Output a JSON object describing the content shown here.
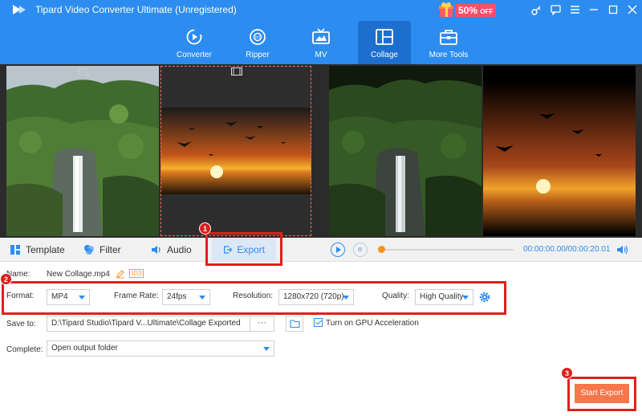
{
  "window": {
    "title": "Tipard Video Converter Ultimate (Unregistered)",
    "promo": {
      "percent": "50%",
      "suffix": "OFF"
    },
    "icons": [
      "key-icon",
      "chat-icon",
      "menu-icon",
      "minimize-icon",
      "maximize-icon",
      "close-icon"
    ]
  },
  "nav": {
    "tabs": [
      {
        "label": "Converter",
        "icon": "converter-icon"
      },
      {
        "label": "Ripper",
        "icon": "ripper-icon"
      },
      {
        "label": "MV",
        "icon": "mv-icon"
      },
      {
        "label": "Collage",
        "icon": "collage-icon",
        "active": true
      },
      {
        "label": "More Tools",
        "icon": "toolbox-icon"
      }
    ]
  },
  "tool_tabs": [
    {
      "label": "Template",
      "icon": "template-icon"
    },
    {
      "label": "Filter",
      "icon": "filter-icon"
    },
    {
      "label": "Audio",
      "icon": "audio-icon"
    },
    {
      "label": "Export",
      "icon": "export-icon",
      "active": true
    }
  ],
  "player": {
    "current_time": "00:00:00.00",
    "separator": "/",
    "total_time": "00:00:20.01",
    "progress": 0
  },
  "export": {
    "name_label": "Name:",
    "name_value": "New Collage.mp4",
    "id3_label": "ID3",
    "format_label": "Format:",
    "format_value": "MP4",
    "frame_rate_label": "Frame Rate:",
    "frame_rate_value": "24fps",
    "resolution_label": "Resolution:",
    "resolution_value": "1280x720 (720p)",
    "quality_label": "Quality:",
    "quality_value": "High Quality",
    "save_to_label": "Save to:",
    "save_to_value": "D:\\Tipard Studio\\Tipard V...Ultimate\\Collage Exported",
    "more_label": "···",
    "gpu_label": "Turn on GPU Acceleration",
    "gpu_checked": true,
    "complete_label": "Complete:",
    "complete_value": "Open output folder",
    "start_export_label": "Start Export"
  },
  "annotations": [
    "1",
    "2",
    "3"
  ],
  "colors": {
    "accent": "#2d8cf0",
    "start_export": "#f7764a",
    "annotation": "#e0201e"
  }
}
